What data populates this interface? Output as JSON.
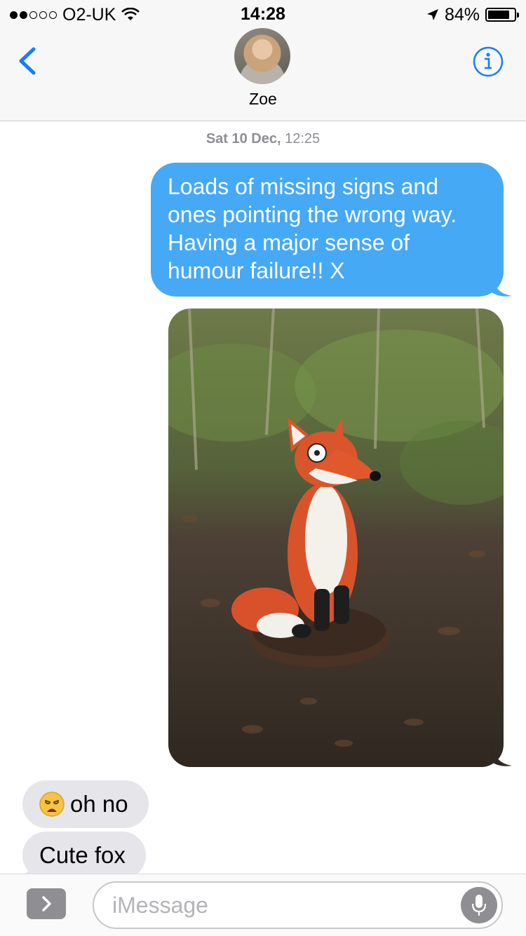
{
  "status_bar": {
    "carrier": "O2-UK",
    "signal_filled": 2,
    "signal_total": 5,
    "time": "14:28",
    "battery": "84%",
    "battery_level": 0.84
  },
  "header": {
    "contact_name": "Zoe",
    "back_icon": "chevron-left-icon",
    "info_icon": "info-icon"
  },
  "conversation": {
    "timestamp_day": "Sat 10 Dec,",
    "timestamp_time": "12:25",
    "messages": [
      {
        "direction": "outgoing",
        "type": "text",
        "text": "Loads of missing signs and ones pointing the wrong way. Having a major sense of humour failure!! X"
      },
      {
        "direction": "outgoing",
        "type": "photo"
      },
      {
        "direction": "incoming",
        "type": "text",
        "emoji": "weary-face",
        "text": "oh no"
      },
      {
        "direction": "incoming",
        "type": "text",
        "text": "Cute fox"
      }
    ]
  },
  "composer": {
    "placeholder": "iMessage",
    "value": "",
    "apps_icon": "chevron-right-icon",
    "mic_icon": "microphone-icon"
  },
  "colors": {
    "accent": "#157efb",
    "outgoing_bubble": "#45a9f6",
    "incoming_bubble": "#e5e5ea"
  }
}
